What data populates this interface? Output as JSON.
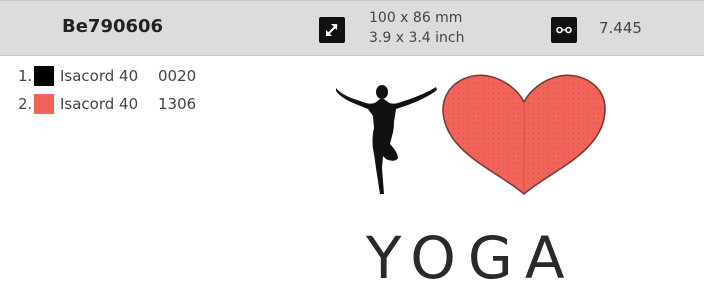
{
  "header": {
    "design_name": "Be790606",
    "size_icon": "resize-arrows-icon",
    "size_mm": "100 x 86 mm",
    "size_inch": "3.9 x 3.4 inch",
    "stitch_icon": "stitch-count-icon",
    "stitch_count": "7.445"
  },
  "colors": [
    {
      "index": "1.",
      "swatch": "#000000",
      "thread": "Isacord 40",
      "code": "0020"
    },
    {
      "index": "2.",
      "swatch": "#f2645a",
      "thread": "Isacord 40",
      "code": "1306"
    }
  ],
  "artwork": {
    "figure_color": "#111111",
    "heart_color": "#f2645a",
    "heart_outline": "#7a3a35",
    "word": "YOGA"
  }
}
